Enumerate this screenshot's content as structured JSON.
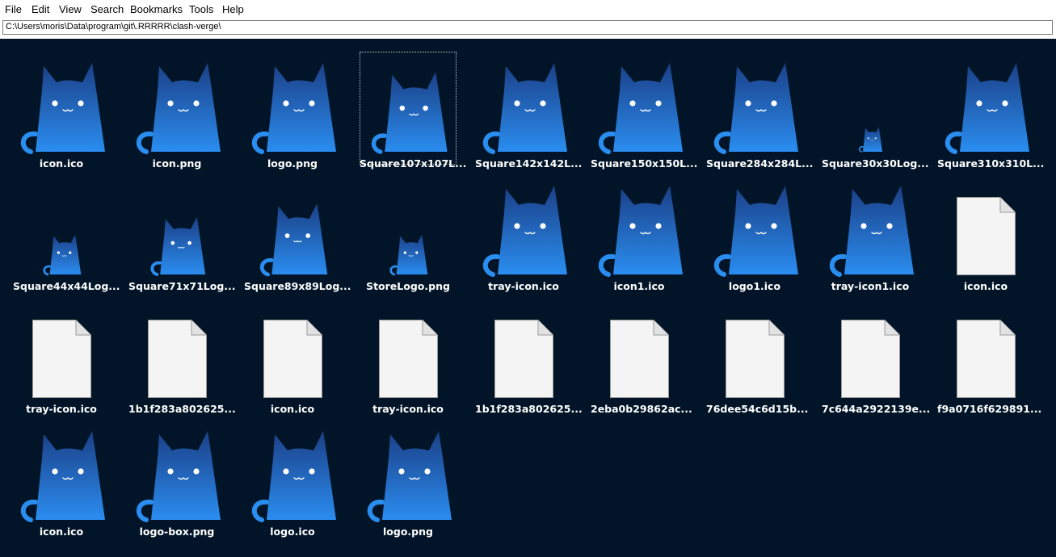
{
  "menu": [
    "File",
    "Edit",
    "View",
    "Search",
    "Bookmarks",
    "Tools",
    "Help"
  ],
  "path": "C:\\Users\\moris\\Data\\program\\git\\.RRRRR\\clash-verge\\",
  "files": [
    {
      "label": "icon.ico",
      "icon": "cat-logo-icon",
      "size": "lg"
    },
    {
      "label": "icon.png",
      "icon": "cat-logo-icon",
      "size": "lg"
    },
    {
      "label": "logo.png",
      "icon": "cat-logo-icon",
      "size": "lg"
    },
    {
      "label": "Square107x107L...",
      "icon": "cat-logo-icon",
      "size": "md",
      "selected": true
    },
    {
      "label": "Square142x142L...",
      "icon": "cat-logo-icon",
      "size": "lg"
    },
    {
      "label": "Square150x150L...",
      "icon": "cat-logo-icon",
      "size": "lg"
    },
    {
      "label": "Square284x284L...",
      "icon": "cat-logo-icon",
      "size": "lg"
    },
    {
      "label": "Square30x30Log...",
      "icon": "cat-logo-icon",
      "size": "xs"
    },
    {
      "label": "Square310x310L...",
      "icon": "cat-logo-icon",
      "size": "lg"
    },
    {
      "label": "Square44x44Log...",
      "icon": "cat-logo-icon",
      "size": "sm"
    },
    {
      "label": "Square71x71Log...",
      "icon": "cat-logo-icon",
      "size": "smd"
    },
    {
      "label": "Square89x89Log...",
      "icon": "cat-logo-icon",
      "size": "mdl"
    },
    {
      "label": "StoreLogo.png",
      "icon": "cat-logo-icon",
      "size": "sm"
    },
    {
      "label": "tray-icon.ico",
      "icon": "cat-logo-icon",
      "size": "lg"
    },
    {
      "label": "icon1.ico",
      "icon": "cat-logo-icon",
      "size": "lg"
    },
    {
      "label": "logo1.ico",
      "icon": "cat-logo-icon",
      "size": "lg"
    },
    {
      "label": "tray-icon1.ico",
      "icon": "cat-logo-icon",
      "size": "lg"
    },
    {
      "label": "icon.ico",
      "icon": "blank-file-icon"
    },
    {
      "label": "tray-icon.ico",
      "icon": "blank-file-icon"
    },
    {
      "label": "1b1f283a802625...",
      "icon": "blank-file-icon"
    },
    {
      "label": "icon.ico",
      "icon": "blank-file-icon"
    },
    {
      "label": "tray-icon.ico",
      "icon": "blank-file-icon"
    },
    {
      "label": "1b1f283a802625...",
      "icon": "blank-file-icon"
    },
    {
      "label": "2eba0b29862ac...",
      "icon": "blank-file-icon"
    },
    {
      "label": "76dee54c6d15b...",
      "icon": "blank-file-icon"
    },
    {
      "label": "7c644a2922139e...",
      "icon": "blank-file-icon"
    },
    {
      "label": "f9a0716f629891...",
      "icon": "blank-file-icon"
    },
    {
      "label": "icon.ico",
      "icon": "cat-logo-icon",
      "size": "lg"
    },
    {
      "label": "logo-box.png",
      "icon": "cat-logo-icon",
      "size": "lg"
    },
    {
      "label": "logo.ico",
      "icon": "cat-logo-icon",
      "size": "lg"
    },
    {
      "label": "logo.png",
      "icon": "cat-logo-icon",
      "size": "lg"
    }
  ],
  "colors": {
    "background": "#021528",
    "cat_top": "#1b3f86",
    "cat_bottom": "#2a8df0",
    "file_fill": "#f4f4f4"
  }
}
